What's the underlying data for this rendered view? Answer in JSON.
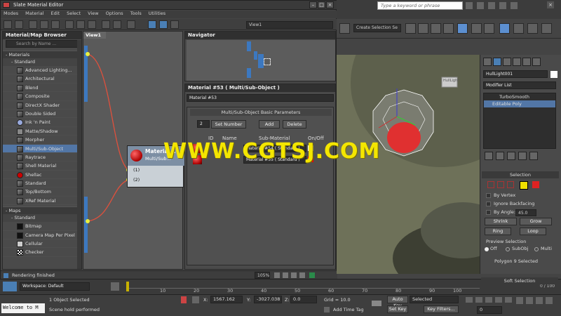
{
  "slate": {
    "title": "Slate Material Editor",
    "menu": [
      "Modes",
      "Material",
      "Edit",
      "Select",
      "View",
      "Options",
      "Tools",
      "Utilities"
    ],
    "view_dropdown": "View1",
    "browser": {
      "title": "Material/Map Browser",
      "search_placeholder": "Search by Name ...",
      "materials_label": "Materials",
      "standard_label": "Standard",
      "materials": [
        "Advanced Lighting...",
        "Architectural",
        "Blend",
        "Composite",
        "DirectX Shader",
        "Double Sided",
        "Ink 'n Paint",
        "Matte/Shadow",
        "Morpher",
        "Multi/Sub-Object",
        "Raytrace",
        "Shell Material",
        "Shellac",
        "Standard",
        "Top/Bottom",
        "XRef Material"
      ],
      "selected_material": "Multi/Sub-Object",
      "maps_label": "Maps",
      "maps_standard_label": "Standard",
      "maps": [
        "Bitmap",
        "Camera Map Per Pixel",
        "Cellular",
        "Checker"
      ]
    },
    "view_tab": "View1",
    "node": {
      "title": "Material...",
      "subtitle": "Multi/Sub...",
      "slot1": "(1)",
      "slot2": "(2)"
    },
    "navigator_title": "Navigator",
    "params": {
      "title": "Material #53  ( Multi/Sub-Object )",
      "name_value": "Material #53",
      "rollout_title": "Multi/Sub-Object Basic Parameters",
      "count": "2",
      "set_number": "Set Number",
      "add": "Add",
      "delete": "Delete",
      "col_id": "ID",
      "col_name": "Name",
      "col_sub": "Sub-Material",
      "col_onoff": "On/Off",
      "row1_sub": "Material #54  ( Standard )",
      "row2_sub": "Material #55  ( Standard )"
    },
    "status": "Rendering finished",
    "zoom": "105%"
  },
  "max": {
    "search_placeholder": "Type a keyword or phrase",
    "selection_set": "Create Selection Se",
    "object_name": "HullLight001",
    "modifier_list": "Modifier List",
    "stack": [
      "TurboSmooth",
      "Editable Poly"
    ],
    "selection_title": "Selection",
    "by_vertex": "By Vertex",
    "ignore_backfacing": "Ignore Backfacing",
    "by_angle": "By Angle:",
    "by_angle_value": "45.0",
    "shrink": "Shrink",
    "grow": "Grow",
    "ring": "Ring",
    "loop": "Loop",
    "preview_selection": "Preview Selection",
    "preview_off": "Off",
    "preview_subobj": "SubObj",
    "preview_multi": "Multi",
    "selected_info": "Polygon 9 Selected",
    "soft_selection": "Soft Selection",
    "viewport_label": "HullLight"
  },
  "bottom": {
    "workspace": "Workspace: Default",
    "ticks": [
      "10",
      "20",
      "30",
      "40",
      "50",
      "60",
      "70",
      "80",
      "90",
      "100"
    ],
    "frame_counter": "0 / 100",
    "maxscript": "Welcome to M",
    "objects_selected": "1 Object Selected",
    "hold_message": "Scene hold performed",
    "x_label": "X:",
    "x_value": "1567.162",
    "y_label": "Y:",
    "y_value": "-3027.038",
    "z_label": "Z:",
    "z_value": "0.0",
    "grid": "Grid = 10.0",
    "add_time_tag": "Add Time Tag",
    "auto_key": "Auto Key",
    "auto_key_value": "Selected",
    "set_key": "Set Key",
    "key_filters": "Key Filters...",
    "frame": "0"
  },
  "watermark": "WWW.CGTSJ.COM"
}
